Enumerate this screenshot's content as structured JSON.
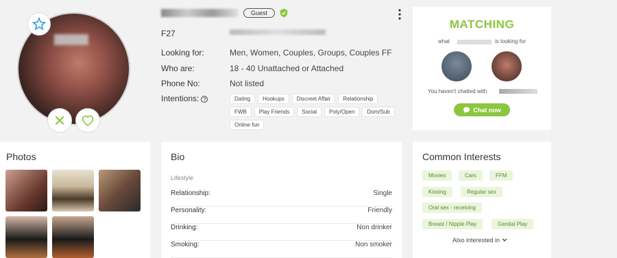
{
  "profile": {
    "badge": "Guest",
    "code": "F27",
    "location": "Adelaide, South Australia",
    "rows": {
      "looking_for_label": "Looking for:",
      "looking_for_value": "Men, Women, Couples, Groups, Couples FF",
      "who_are_label": "Who are:",
      "who_are_value": "18 - 40 Unattached or Attached",
      "phone_label": "Phone No:",
      "phone_value": "Not listed",
      "intentions_label": "Intentions:"
    },
    "intentions": [
      "Dating",
      "Hookups",
      "Discreet Affair",
      "Relationship",
      "FWB",
      "Play Friends",
      "Social",
      "Poly/Open",
      "Dom/Sub",
      "Online fun"
    ]
  },
  "matching": {
    "title": "MATCHING",
    "what": "what",
    "looking_for": "is looking for",
    "chat_note": "You haven't chatted with",
    "chat_button": "Chat now"
  },
  "photos": {
    "title": "Photos"
  },
  "bio": {
    "title": "Bio",
    "section": "Lifestyle",
    "rows": [
      {
        "label": "Relationship:",
        "value": "Single"
      },
      {
        "label": "Personality:",
        "value": "Friendly"
      },
      {
        "label": "Drinking:",
        "value": "Non drinker"
      },
      {
        "label": "Smoking:",
        "value": "Non smoker"
      }
    ]
  },
  "interests": {
    "title": "Common Interests",
    "tags": [
      "Movies",
      "Cars",
      "FFM",
      "Kissing",
      "Regular sex",
      "Oral sex - receiving",
      "Breast / Nipple Play",
      "Genital Play"
    ],
    "also": "Also interested in"
  },
  "colors": {
    "accent": "#8cc63f",
    "tag_bg": "#e9f5dd"
  },
  "icons": [
    "star-icon",
    "close-icon",
    "heart-icon",
    "shield-check-icon",
    "kebab-icon",
    "help-icon",
    "chat-bubble-icon",
    "chevron-down-icon"
  ]
}
